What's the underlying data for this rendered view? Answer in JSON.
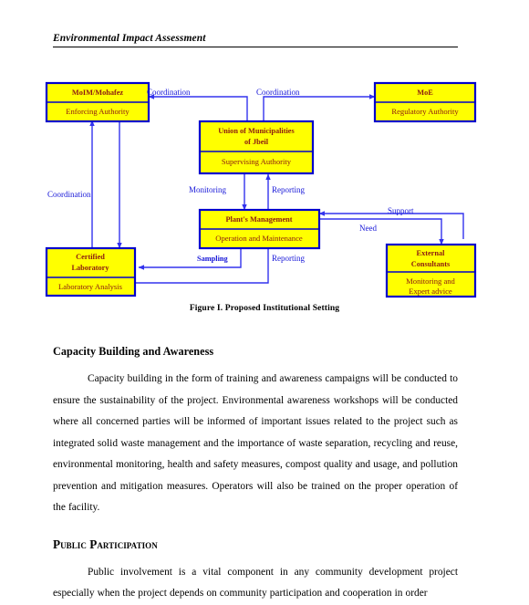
{
  "header": {
    "running_title": "Environmental Impact Assessment"
  },
  "figure": {
    "caption": "Figure I.  Proposed Institutional Setting",
    "colors": {
      "box_fill": "#ffff00",
      "box_border": "#0000cc",
      "box_text": "#8b1a12",
      "edge": "#3333ee",
      "edge_label": "#1616d8"
    },
    "boxes": [
      {
        "id": "moim",
        "title": "MoIM/Mohafez",
        "subtitle": "Enforcing Authority"
      },
      {
        "id": "moe",
        "title": "MoE",
        "subtitle": "Regulatory Authority"
      },
      {
        "id": "union",
        "title": "Union of Municipalities",
        "title2": "of Jbeil",
        "subtitle": "Supervising Authority"
      },
      {
        "id": "plant",
        "title": "Plant's Management",
        "subtitle": "Operation and Maintenance"
      },
      {
        "id": "lab",
        "title": "Certified",
        "title2": "Laboratory",
        "subtitle": "Laboratory Analysis"
      },
      {
        "id": "consult",
        "title": "External",
        "title2": "Consultants",
        "subtitle": "Monitoring and",
        "subtitle2": "Expert advice"
      }
    ],
    "edge_labels": [
      {
        "id": "coord-left",
        "text": "Coordination"
      },
      {
        "id": "coord-right",
        "text": "Coordination"
      },
      {
        "id": "coord-side",
        "text": "Coordination"
      },
      {
        "id": "monitoring",
        "text": "Monitoring"
      },
      {
        "id": "reporting-up",
        "text": "Reporting"
      },
      {
        "id": "sampling",
        "text": "Sampling"
      },
      {
        "id": "reporting-lo",
        "text": "Reporting"
      },
      {
        "id": "support",
        "text": "Support"
      },
      {
        "id": "need",
        "text": "Need"
      }
    ]
  },
  "body": {
    "sections": [
      {
        "id": "capacity-building",
        "heading": "Capacity Building and Awareness",
        "smallcaps": false,
        "paragraphs": [
          "Capacity building in the form of training and awareness campaigns will be conducted to ensure the sustainability of the project.  Environmental awareness workshops will be conducted where all concerned parties will be informed of important issues related to the project such as integrated solid waste management and the importance of waste separation, recycling and reuse, environmental monitoring, health and safety measures, compost quality and usage, and pollution prevention and mitigation measures.  Operators will also be trained on the proper operation of the facility."
        ]
      },
      {
        "id": "public-participation",
        "heading": "Public Participation",
        "smallcaps": true,
        "paragraphs": [
          "Public involvement is a vital component in any community development project especially when the project depends on community participation and cooperation in order"
        ]
      }
    ]
  }
}
